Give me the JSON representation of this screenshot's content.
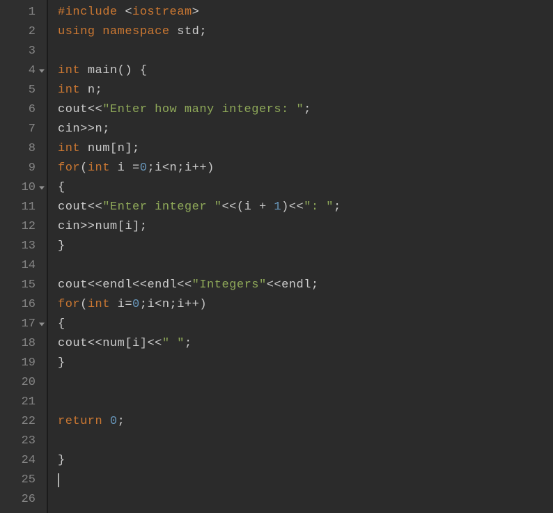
{
  "lineCount": 26,
  "foldLines": [
    4,
    10,
    17
  ],
  "cursorLine": 25,
  "code": {
    "l1": [
      {
        "c": "pp",
        "t": "#include "
      },
      {
        "c": "lt",
        "t": "<"
      },
      {
        "c": "t",
        "t": "iostream"
      },
      {
        "c": "lt",
        "t": ">"
      }
    ],
    "l2": [
      {
        "c": "k",
        "t": "using"
      },
      {
        "c": "p",
        "t": " "
      },
      {
        "c": "k",
        "t": "namespace"
      },
      {
        "c": "p",
        "t": " "
      },
      {
        "c": "id",
        "t": "std"
      },
      {
        "c": "p",
        "t": ";"
      }
    ],
    "l3": [],
    "l4": [
      {
        "c": "t",
        "t": "int"
      },
      {
        "c": "p",
        "t": " "
      },
      {
        "c": "id",
        "t": "main"
      },
      {
        "c": "p",
        "t": "() {"
      }
    ],
    "l5": [
      {
        "c": "t",
        "t": "int"
      },
      {
        "c": "p",
        "t": " "
      },
      {
        "c": "id",
        "t": "n"
      },
      {
        "c": "p",
        "t": ";"
      }
    ],
    "l6": [
      {
        "c": "id",
        "t": "cout"
      },
      {
        "c": "op",
        "t": "<<"
      },
      {
        "c": "s",
        "t": "\"Enter how many integers: \""
      },
      {
        "c": "p",
        "t": ";"
      }
    ],
    "l7": [
      {
        "c": "id",
        "t": "cin"
      },
      {
        "c": "op",
        "t": ">>"
      },
      {
        "c": "id",
        "t": "n"
      },
      {
        "c": "p",
        "t": ";"
      }
    ],
    "l8": [
      {
        "c": "t",
        "t": "int"
      },
      {
        "c": "p",
        "t": " "
      },
      {
        "c": "id",
        "t": "num"
      },
      {
        "c": "p",
        "t": "["
      },
      {
        "c": "id",
        "t": "n"
      },
      {
        "c": "p",
        "t": "];"
      }
    ],
    "l9": [
      {
        "c": "k",
        "t": "for"
      },
      {
        "c": "p",
        "t": "("
      },
      {
        "c": "t",
        "t": "int"
      },
      {
        "c": "p",
        "t": " "
      },
      {
        "c": "id",
        "t": "i"
      },
      {
        "c": "p",
        "t": " "
      },
      {
        "c": "op",
        "t": "="
      },
      {
        "c": "n",
        "t": "0"
      },
      {
        "c": "p",
        "t": ";"
      },
      {
        "c": "id",
        "t": "i"
      },
      {
        "c": "op",
        "t": "<"
      },
      {
        "c": "id",
        "t": "n"
      },
      {
        "c": "p",
        "t": ";"
      },
      {
        "c": "id",
        "t": "i"
      },
      {
        "c": "op",
        "t": "++"
      },
      {
        "c": "p",
        "t": ")"
      }
    ],
    "l10": [
      {
        "c": "p",
        "t": "{"
      }
    ],
    "l11": [
      {
        "c": "id",
        "t": "cout"
      },
      {
        "c": "op",
        "t": "<<"
      },
      {
        "c": "s",
        "t": "\"Enter integer \""
      },
      {
        "c": "op",
        "t": "<<"
      },
      {
        "c": "p",
        "t": "("
      },
      {
        "c": "id",
        "t": "i"
      },
      {
        "c": "p",
        "t": " "
      },
      {
        "c": "op",
        "t": "+"
      },
      {
        "c": "p",
        "t": " "
      },
      {
        "c": "n",
        "t": "1"
      },
      {
        "c": "p",
        "t": ")"
      },
      {
        "c": "op",
        "t": "<<"
      },
      {
        "c": "s",
        "t": "\": \""
      },
      {
        "c": "p",
        "t": ";"
      }
    ],
    "l12": [
      {
        "c": "id",
        "t": "cin"
      },
      {
        "c": "op",
        "t": ">>"
      },
      {
        "c": "id",
        "t": "num"
      },
      {
        "c": "p",
        "t": "["
      },
      {
        "c": "id",
        "t": "i"
      },
      {
        "c": "p",
        "t": "];"
      }
    ],
    "l13": [
      {
        "c": "p",
        "t": "}"
      }
    ],
    "l14": [],
    "l15": [
      {
        "c": "id",
        "t": "cout"
      },
      {
        "c": "op",
        "t": "<<"
      },
      {
        "c": "id",
        "t": "endl"
      },
      {
        "c": "op",
        "t": "<<"
      },
      {
        "c": "id",
        "t": "endl"
      },
      {
        "c": "op",
        "t": "<<"
      },
      {
        "c": "s",
        "t": "\"Integers\""
      },
      {
        "c": "op",
        "t": "<<"
      },
      {
        "c": "id",
        "t": "endl"
      },
      {
        "c": "p",
        "t": ";"
      }
    ],
    "l16": [
      {
        "c": "k",
        "t": "for"
      },
      {
        "c": "p",
        "t": "("
      },
      {
        "c": "t",
        "t": "int"
      },
      {
        "c": "p",
        "t": " "
      },
      {
        "c": "id",
        "t": "i"
      },
      {
        "c": "op",
        "t": "="
      },
      {
        "c": "n",
        "t": "0"
      },
      {
        "c": "p",
        "t": ";"
      },
      {
        "c": "id",
        "t": "i"
      },
      {
        "c": "op",
        "t": "<"
      },
      {
        "c": "id",
        "t": "n"
      },
      {
        "c": "p",
        "t": ";"
      },
      {
        "c": "id",
        "t": "i"
      },
      {
        "c": "op",
        "t": "++"
      },
      {
        "c": "p",
        "t": ")"
      }
    ],
    "l17": [
      {
        "c": "p",
        "t": "{"
      }
    ],
    "l18": [
      {
        "c": "id",
        "t": "cout"
      },
      {
        "c": "op",
        "t": "<<"
      },
      {
        "c": "id",
        "t": "num"
      },
      {
        "c": "p",
        "t": "["
      },
      {
        "c": "id",
        "t": "i"
      },
      {
        "c": "p",
        "t": "]"
      },
      {
        "c": "op",
        "t": "<<"
      },
      {
        "c": "s",
        "t": "\" \""
      },
      {
        "c": "p",
        "t": ";"
      }
    ],
    "l19": [
      {
        "c": "p",
        "t": "}"
      }
    ],
    "l20": [],
    "l21": [],
    "l22": [
      {
        "c": "k",
        "t": "return"
      },
      {
        "c": "p",
        "t": " "
      },
      {
        "c": "n",
        "t": "0"
      },
      {
        "c": "p",
        "t": ";"
      }
    ],
    "l23": [],
    "l24": [
      {
        "c": "p",
        "t": "}"
      }
    ],
    "l25": [],
    "l26": []
  }
}
